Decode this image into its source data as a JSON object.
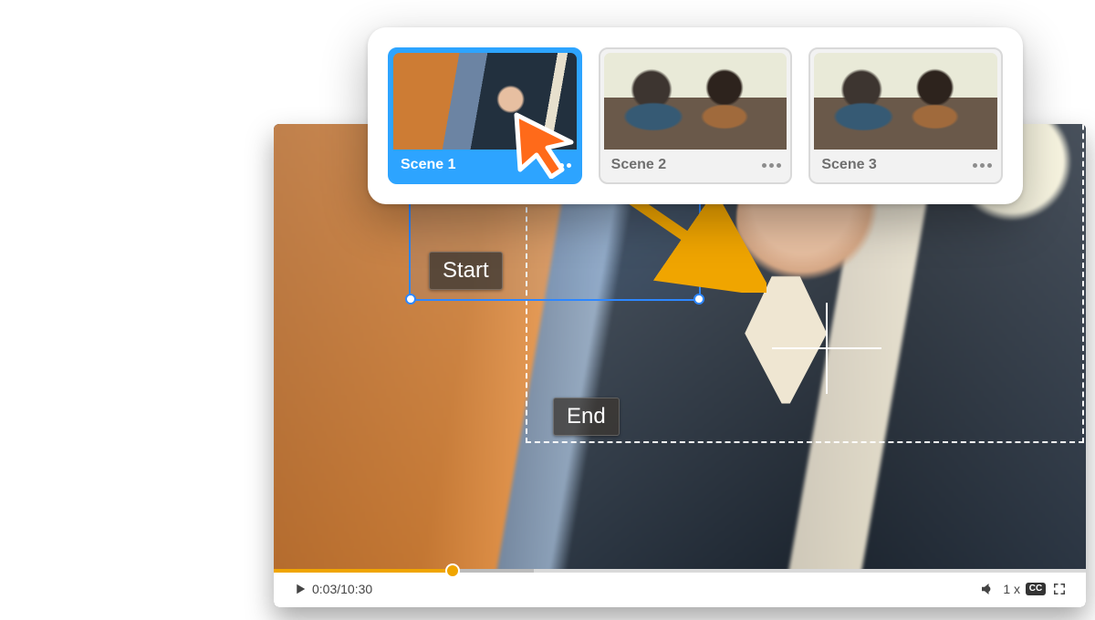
{
  "scenes": [
    {
      "label": "Scene 1",
      "active": true
    },
    {
      "label": "Scene 2",
      "active": false
    },
    {
      "label": "Scene 3",
      "active": false
    }
  ],
  "overlay": {
    "start_label": "Start",
    "end_label": "End"
  },
  "player": {
    "current_time": "0:03",
    "duration": "10:30",
    "time_separator": " / ",
    "speed_label": "1 x",
    "cc_label": "CC",
    "progress_played_pct": 22,
    "progress_buffer_pct": 32
  },
  "colors": {
    "accent_blue": "#2da4ff",
    "accent_orange": "#f0a500",
    "cursor_orange": "#ff6a1a"
  }
}
